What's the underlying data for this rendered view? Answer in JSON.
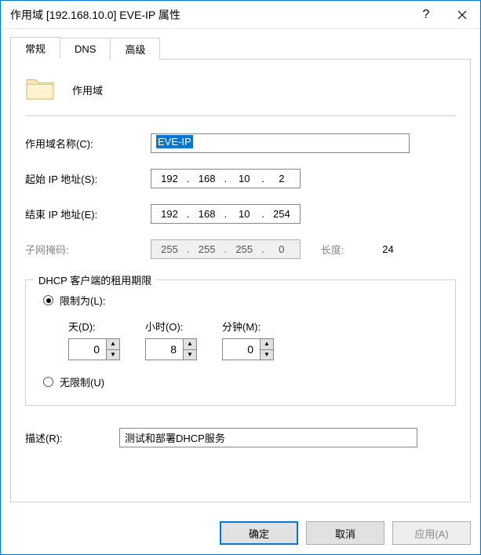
{
  "titlebar": {
    "title": "作用域 [192.168.10.0] EVE-IP 属性",
    "help": "?"
  },
  "tabs": [
    {
      "label": "常规",
      "active": true
    },
    {
      "label": "DNS",
      "active": false
    },
    {
      "label": "高级",
      "active": false
    }
  ],
  "header": {
    "label": "作用域"
  },
  "fields": {
    "name_label": "作用域名称(C):",
    "name_value": "EVE-IP",
    "start_label": "起始 IP 地址(S):",
    "start_ip": [
      "192",
      "168",
      "10",
      "2"
    ],
    "end_label": "结束 IP 地址(E):",
    "end_ip": [
      "192",
      "168",
      "10",
      "254"
    ],
    "mask_label": "子网掩码:",
    "mask_ip": [
      "255",
      "255",
      "255",
      "0"
    ],
    "length_label": "长度:",
    "length_value": "24"
  },
  "lease": {
    "legend": "DHCP 客户端的租用期限",
    "limited_label": "限制为(L):",
    "unlimited_label": "无限制(U)",
    "days_label": "天(D):",
    "days_value": "0",
    "hours_label": "小时(O):",
    "hours_value": "8",
    "minutes_label": "分钟(M):",
    "minutes_value": "0",
    "selected": "limited"
  },
  "description": {
    "label": "描述(R):",
    "value": "测试和部署DHCP服务"
  },
  "buttons": {
    "ok": "确定",
    "cancel": "取消",
    "apply": "应用(A)"
  }
}
